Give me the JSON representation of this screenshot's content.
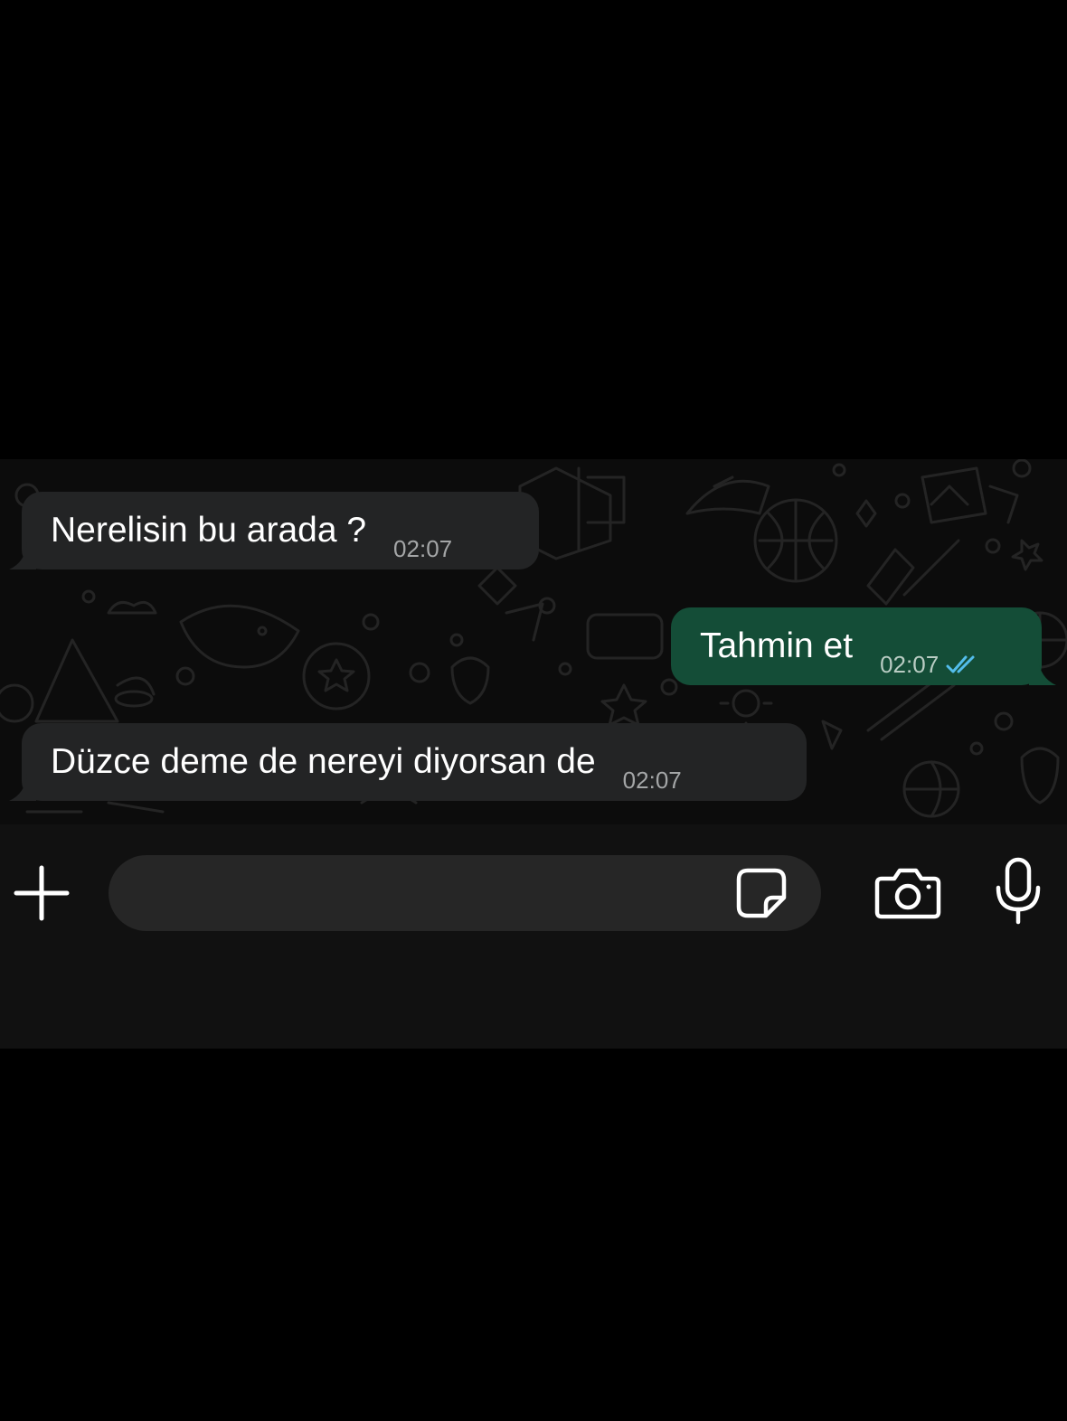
{
  "messages": [
    {
      "direction": "incoming",
      "text": "Nerelisin bu arada ?",
      "time": "02:07"
    },
    {
      "direction": "outgoing",
      "text": "Tahmin et",
      "time": "02:07",
      "status": "read"
    },
    {
      "direction": "incoming",
      "text": "Düzce deme de nereyi diyorsan de",
      "time": "02:07"
    }
  ],
  "composer": {
    "placeholder": "",
    "value": ""
  },
  "icons": {
    "attach": "plus-icon",
    "sticker": "sticker-icon",
    "camera": "camera-icon",
    "voice": "microphone-icon",
    "read_receipt": "double-check-icon"
  },
  "colors": {
    "incoming_bubble": "#232425",
    "outgoing_bubble": "#144d37",
    "read_receipt": "#53bdeb",
    "input_field": "#262626"
  }
}
